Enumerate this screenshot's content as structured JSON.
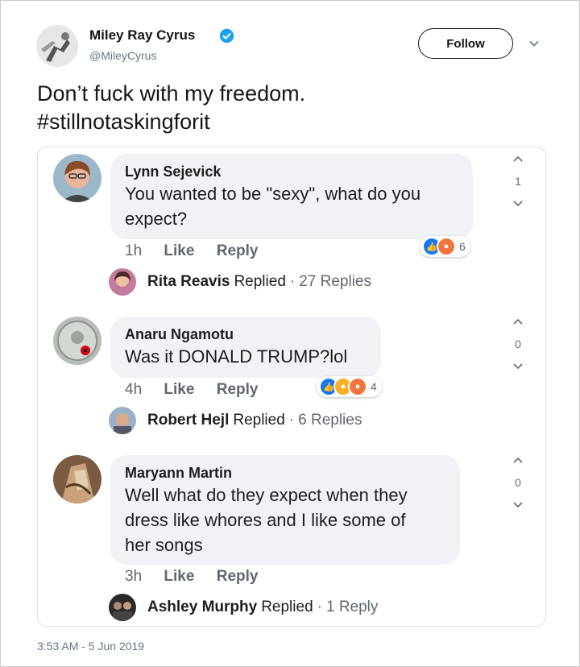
{
  "tweet": {
    "author_name": "Miley Ray Cyrus",
    "handle": "@MileyCyrus",
    "follow_label": "Follow",
    "text_lines": [
      "Don’t fuck with my freedom.",
      "#stillnotaskingforit"
    ],
    "timestamp": "3:53 AM - 5 Jun 2019",
    "colors": {
      "verified": "#1da1f2",
      "text": "#14171a",
      "muted": "#657786"
    }
  },
  "comments": [
    {
      "name": "Lynn Sejevick",
      "text_lines": [
        "You wanted to be \"sexy\", what do you",
        "expect?"
      ],
      "time": "1h",
      "like_label": "Like",
      "reply_label": "Reply",
      "reaction_count": "6",
      "reaction_icons": [
        "like-icon",
        "angry-icon"
      ],
      "vote_count": "1",
      "replied": {
        "name": "Rita Reavis",
        "verb": "Replied",
        "separator": "·",
        "count": "27 Replies"
      }
    },
    {
      "name": "Anaru Ngamotu",
      "text_lines": [
        "Was it DONALD TRUMP?lol"
      ],
      "time": "4h",
      "like_label": "Like",
      "reply_label": "Reply",
      "reaction_count": "4",
      "reaction_icons": [
        "like-icon",
        "haha-icon",
        "angry-icon"
      ],
      "vote_count": "0",
      "replied": {
        "name": "Robert Hejl",
        "verb": "Replied",
        "separator": "·",
        "count": "6 Replies"
      }
    },
    {
      "name": "Maryann Martin",
      "text_lines": [
        "Well what do they expect when they",
        "dress like whores and I like some of",
        "her songs"
      ],
      "time": "3h",
      "like_label": "Like",
      "reply_label": "Reply",
      "vote_count": "0",
      "replied": {
        "name": "Ashley Murphy",
        "verb": "Replied",
        "separator": "·",
        "count": "1 Reply"
      }
    }
  ]
}
